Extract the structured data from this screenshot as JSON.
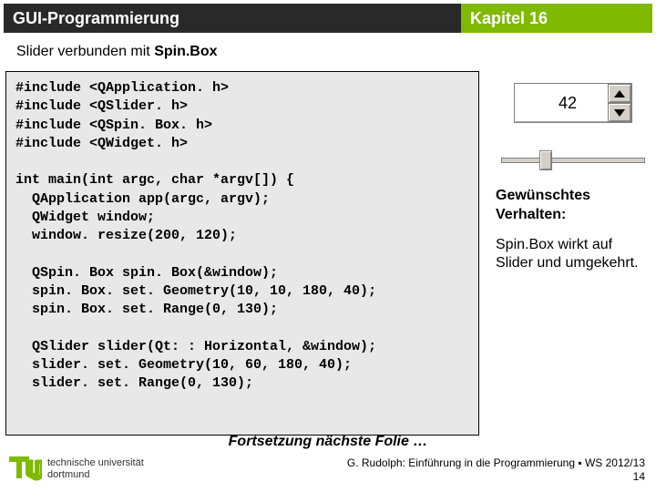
{
  "header": {
    "left": "GUI-Programmierung",
    "right": "Kapitel 16"
  },
  "subtitle": {
    "plain": "Slider verbunden mit ",
    "bold": "Spin.Box"
  },
  "code": "#include <QApplication. h>\n#include <QSlider. h>\n#include <QSpin. Box. h>\n#include <QWidget. h>\n\nint main(int argc, char *argv[]) {\n  QApplication app(argc, argv);\n  QWidget window;\n  window. resize(200, 120);\n\n  QSpin. Box spin. Box(&window);\n  spin. Box. set. Geometry(10, 10, 180, 40);\n  spin. Box. set. Range(0, 130);\n\n  QSlider slider(Qt: : Horizontal, &window);\n  slider. set. Geometry(10, 60, 180, 40);\n  slider. set. Range(0, 130);",
  "spinbox": {
    "value": "42"
  },
  "side": {
    "behavior_label": "Gewünschtes Verhalten:",
    "behavior_text": "Spin.Box wirkt auf Slider und umgekehrt."
  },
  "continuation": "Fortsetzung nächste Folie …",
  "footer": {
    "line": "G. Rudolph: Einführung in die Programmierung ▪ WS 2012/13",
    "page": "14",
    "uni1": "technische universität",
    "uni2": "dortmund"
  },
  "colors": {
    "accent": "#7fb900",
    "headerbg": "#292929"
  }
}
